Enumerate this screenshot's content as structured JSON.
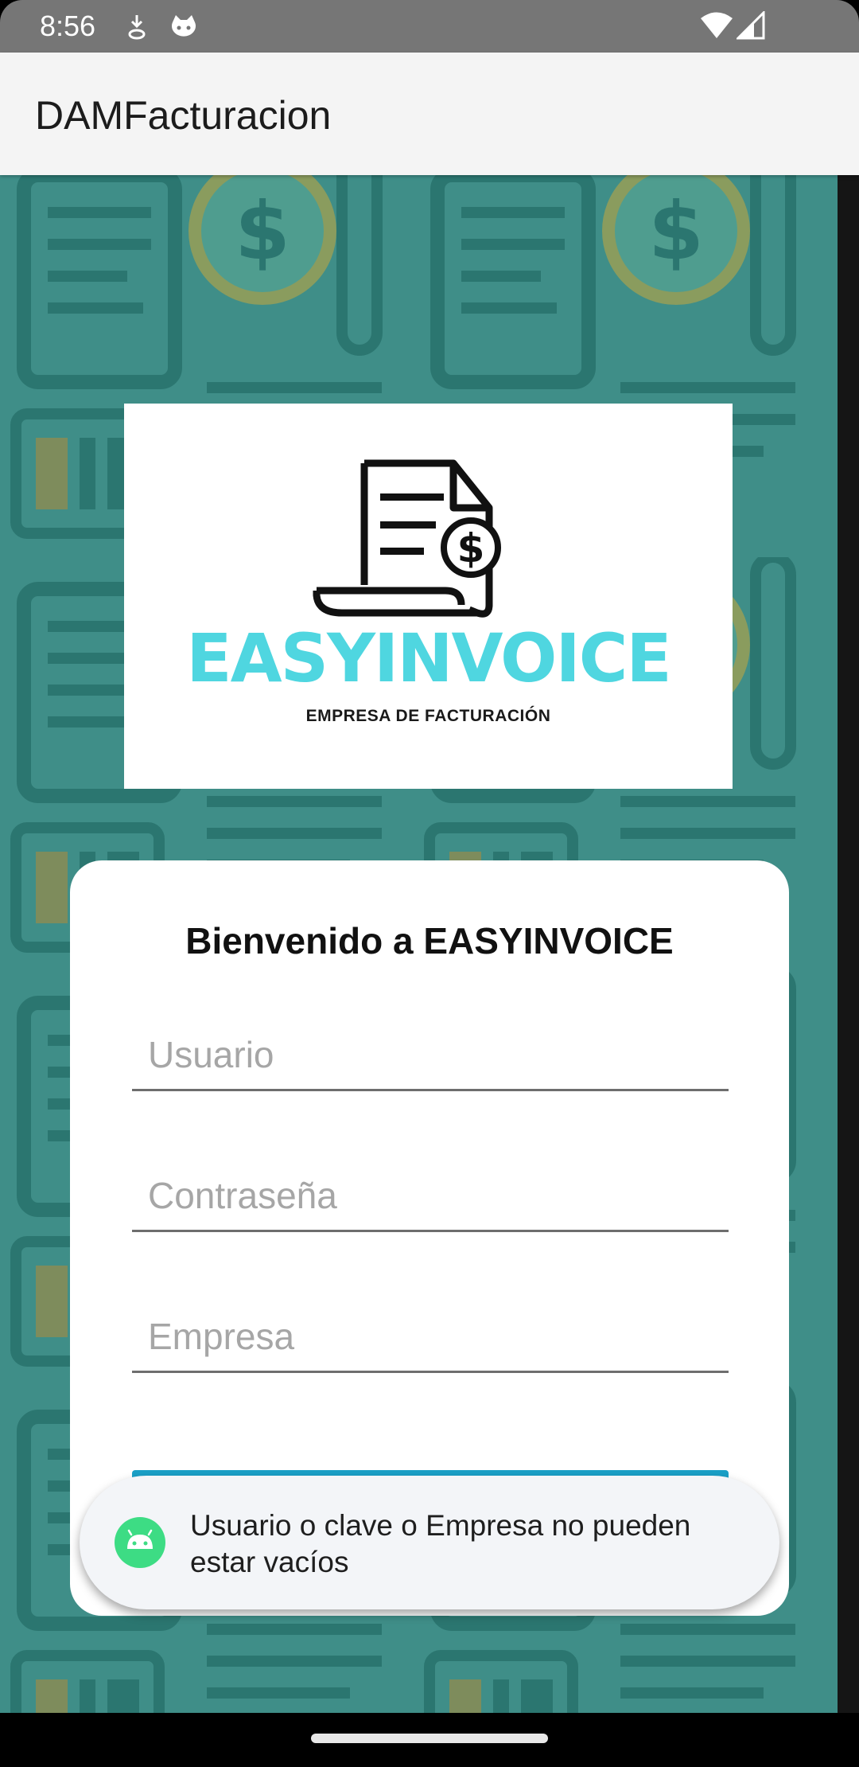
{
  "status_bar": {
    "time": "8:56",
    "icons": [
      "download-icon",
      "cat-face-icon",
      "wifi-icon",
      "signal-icon"
    ]
  },
  "app_bar": {
    "title": "DAMFacturacion"
  },
  "logo": {
    "brand": "EASYINVOICE",
    "tagline": "EMPRESA DE FACTURACIÓN",
    "brand_color": "#4fd6e0",
    "icon": "invoice-dollar-icon"
  },
  "login": {
    "welcome": "Bienvenido a EASYINVOICE",
    "user_placeholder": "Usuario",
    "password_placeholder": "Contraseña",
    "company_placeholder": "Empresa",
    "button_color": "#1aa0c7"
  },
  "toast": {
    "message": "Usuario o clave o Empresa no pueden estar vacíos",
    "icon": "android-icon"
  },
  "colors": {
    "background_pattern": "#3f8e88",
    "app_bar": "#f4f4f4",
    "status_bar": "#767676"
  }
}
